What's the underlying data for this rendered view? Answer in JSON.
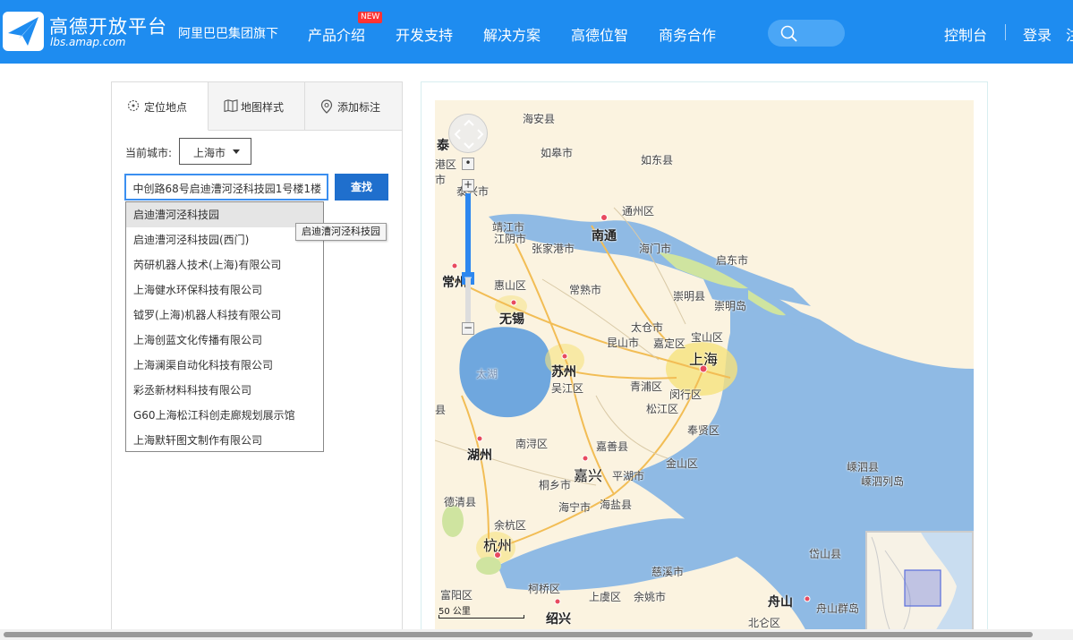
{
  "brand": {
    "title": "高德开放平台",
    "subtitle": "lbs.amap.com",
    "group": "阿里巴巴集团旗下"
  },
  "nav": {
    "items": [
      "产品介绍",
      "开发支持",
      "解决方案",
      "高德位智",
      "商务合作"
    ],
    "new_badge": "NEW",
    "console": "控制台",
    "login": "登录",
    "register": "注"
  },
  "tabs": [
    "定位地点",
    "地图样式",
    "添加标注"
  ],
  "city": {
    "label": "当前城市:",
    "value": "上海市"
  },
  "search": {
    "value": "中创路68号启迪漕河泾科技园1号楼1楼",
    "button": "查找"
  },
  "suggestions": [
    "启迪漕河泾科技园",
    "启迪漕河泾科技园(西门)",
    "芮研机器人技术(上海)有限公司",
    "上海健水环保科技有限公司",
    "钺罗(上海)机器人科技有限公司",
    "上海创蓝文化传播有限公司",
    "上海澜渠自动化科技有限公司",
    "彩丞新材料科技有限公司",
    "G60上海松江科创走廊规划展示馆",
    "上海默轩图文制作有限公司"
  ],
  "tooltip": "启迪漕河泾科技园",
  "map": {
    "scale": "50 公里",
    "labels": [
      {
        "t": "海安县"
      },
      {
        "t": "泰"
      },
      {
        "t": "如皋市"
      },
      {
        "t": "如东县"
      },
      {
        "t": "港区"
      },
      {
        "t": "市"
      },
      {
        "t": "泰兴市"
      },
      {
        "t": "通州区"
      },
      {
        "t": "靖江市"
      },
      {
        "t": "江阴市"
      },
      {
        "t": "张家港市"
      },
      {
        "t": "南通"
      },
      {
        "t": "海门市"
      },
      {
        "t": "启东市"
      },
      {
        "t": "常州"
      },
      {
        "t": "惠山区"
      },
      {
        "t": "常熟市"
      },
      {
        "t": "崇明县"
      },
      {
        "t": "崇明岛"
      },
      {
        "t": "无锡"
      },
      {
        "t": "太仓市"
      },
      {
        "t": "宝山区"
      },
      {
        "t": "昆山市"
      },
      {
        "t": "嘉定区"
      },
      {
        "t": "上海"
      },
      {
        "t": "太湖"
      },
      {
        "t": "苏州"
      },
      {
        "t": "吴江区"
      },
      {
        "t": "青浦区"
      },
      {
        "t": "闵行区"
      },
      {
        "t": "县"
      },
      {
        "t": "松江区"
      },
      {
        "t": "奉贤区"
      },
      {
        "t": "南浔区"
      },
      {
        "t": "嘉善县"
      },
      {
        "t": "湖州"
      },
      {
        "t": "金山区"
      },
      {
        "t": "嘉兴"
      },
      {
        "t": "平湖市"
      },
      {
        "t": "桐乡市"
      },
      {
        "t": "嵊泗县"
      },
      {
        "t": "嵊泗列岛"
      },
      {
        "t": "德清县"
      },
      {
        "t": "海宁市"
      },
      {
        "t": "海盐县"
      },
      {
        "t": "余杭区"
      },
      {
        "t": "杭州"
      },
      {
        "t": "岱山县"
      },
      {
        "t": "慈溪市"
      },
      {
        "t": "富阳区"
      },
      {
        "t": "柯桥区"
      },
      {
        "t": "上虞区"
      },
      {
        "t": "余姚市"
      },
      {
        "t": "舟山"
      },
      {
        "t": "舟山群岛"
      },
      {
        "t": "绍兴"
      },
      {
        "t": "北仑区"
      }
    ]
  },
  "colors": {
    "header": "#1e8cf0",
    "button": "#1f6fcd",
    "water": "#6fa7de",
    "land": "#fbf3e0"
  }
}
